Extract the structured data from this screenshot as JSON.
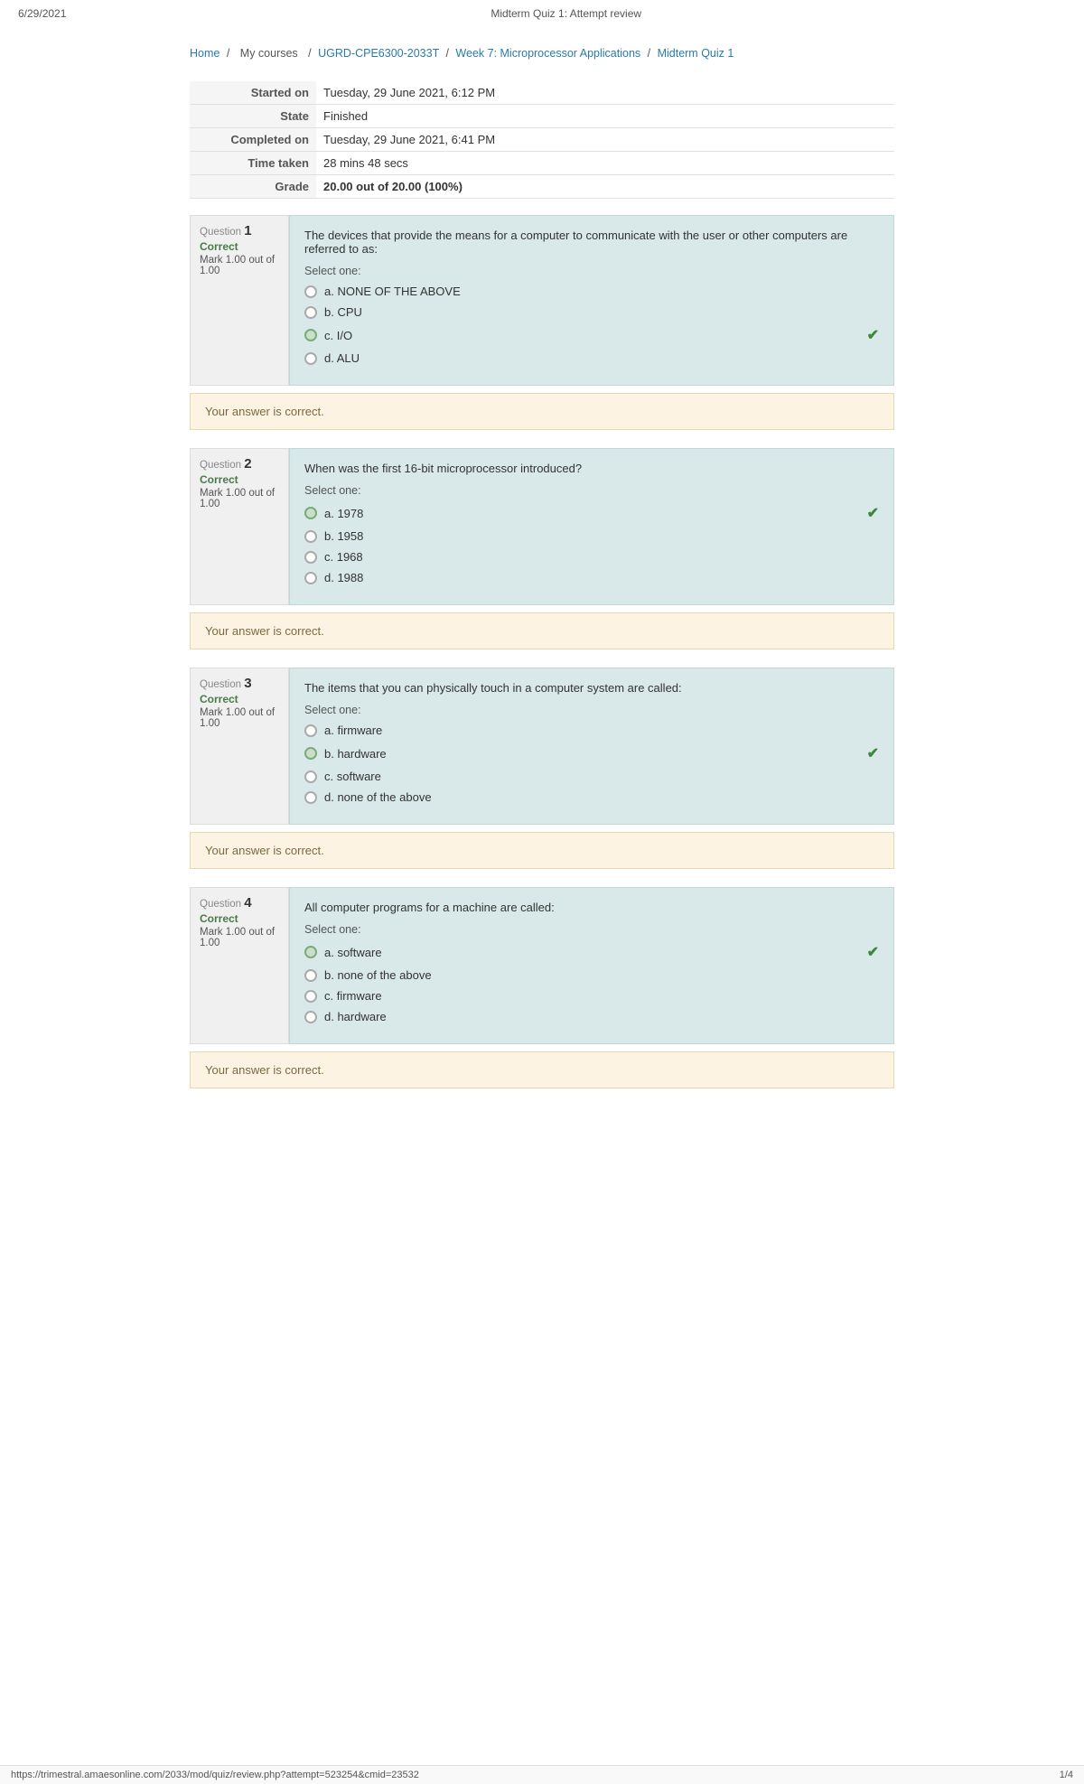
{
  "topbar": {
    "date": "6/29/2021",
    "title": "Midterm Quiz 1: Attempt review"
  },
  "breadcrumb": {
    "home": "Home",
    "mycourses": "My courses",
    "course": "UGRD-CPE6300-2033T",
    "week": "Week 7: Microprocessor Applications",
    "quiz": "Midterm Quiz 1",
    "separator": "/"
  },
  "summary": {
    "started_label": "Started on",
    "started_value": "Tuesday, 29 June 2021, 6:12 PM",
    "state_label": "State",
    "state_value": "Finished",
    "completed_label": "Completed on",
    "completed_value": "Tuesday, 29 June 2021, 6:41 PM",
    "timetaken_label": "Time taken",
    "timetaken_value": "28 mins 48 secs",
    "grade_label": "Grade",
    "grade_value": "20.00 out of 20.00 (100%)"
  },
  "questions": [
    {
      "number": "1",
      "status": "Correct",
      "mark": "Mark 1.00 out of 1.00",
      "text": "The devices that provide the means for a computer to communicate with the user or other computers are referred to as:",
      "select_label": "Select one:",
      "options": [
        {
          "id": "a",
          "label": "a. NONE OF THE ABOVE",
          "selected": false
        },
        {
          "id": "b",
          "label": "b. CPU",
          "selected": false
        },
        {
          "id": "c",
          "label": "c. I/O",
          "selected": true,
          "correct": true
        },
        {
          "id": "d",
          "label": "d. ALU",
          "selected": false
        }
      ],
      "feedback": "Your answer is correct."
    },
    {
      "number": "2",
      "status": "Correct",
      "mark": "Mark 1.00 out of 1.00",
      "text": "When was the first 16-bit microprocessor introduced?",
      "select_label": "Select one:",
      "options": [
        {
          "id": "a",
          "label": "a. 1978",
          "selected": true,
          "correct": true
        },
        {
          "id": "b",
          "label": "b. 1958",
          "selected": false
        },
        {
          "id": "c",
          "label": "c. 1968",
          "selected": false
        },
        {
          "id": "d",
          "label": "d. 1988",
          "selected": false
        }
      ],
      "feedback": "Your answer is correct."
    },
    {
      "number": "3",
      "status": "Correct",
      "mark": "Mark 1.00 out of 1.00",
      "text": "The items that you can physically touch in a computer system are called:",
      "select_label": "Select one:",
      "options": [
        {
          "id": "a",
          "label": "a. firmware",
          "selected": false
        },
        {
          "id": "b",
          "label": "b. hardware",
          "selected": true,
          "correct": true
        },
        {
          "id": "c",
          "label": "c. software",
          "selected": false
        },
        {
          "id": "d",
          "label": "d. none of the above",
          "selected": false
        }
      ],
      "feedback": "Your answer is correct."
    },
    {
      "number": "4",
      "status": "Correct",
      "mark": "Mark 1.00 out of 1.00",
      "text": "All computer programs for a machine are called:",
      "select_label": "Select one:",
      "options": [
        {
          "id": "a",
          "label": "a. software",
          "selected": true,
          "correct": true
        },
        {
          "id": "b",
          "label": "b. none of the above",
          "selected": false
        },
        {
          "id": "c",
          "label": "c. firmware",
          "selected": false
        },
        {
          "id": "d",
          "label": "d. hardware",
          "selected": false
        }
      ],
      "feedback": "Your answer is correct."
    }
  ],
  "footer": {
    "url": "https://trimestral.amaesonline.com/2033/mod/quiz/review.php?attempt=523254&cmid=23532",
    "pagination": "1/4"
  }
}
